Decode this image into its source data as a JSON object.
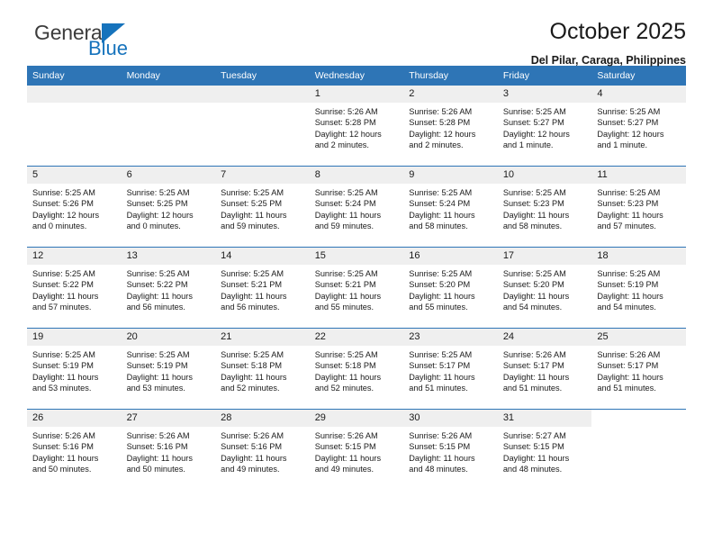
{
  "logo": {
    "word_top": "General",
    "word_bottom": "Blue",
    "triangle_color": "#1673bc"
  },
  "header": {
    "title": "October 2025",
    "location": "Del Pilar, Caraga, Philippines"
  },
  "calendar": {
    "accent_color": "#2e75b6",
    "daynum_band_color": "#efefef",
    "weekday_headers": [
      "Sunday",
      "Monday",
      "Tuesday",
      "Wednesday",
      "Thursday",
      "Friday",
      "Saturday"
    ],
    "labels": {
      "sunrise_prefix": "Sunrise:",
      "sunset_prefix": "Sunset:",
      "daylight_prefix": "Daylight:"
    },
    "weeks": [
      [
        {
          "day": "",
          "sunrise": "",
          "sunset": "",
          "daylight": "",
          "blank": true
        },
        {
          "day": "",
          "sunrise": "",
          "sunset": "",
          "daylight": "",
          "blank": true
        },
        {
          "day": "",
          "sunrise": "",
          "sunset": "",
          "daylight": "",
          "blank": true
        },
        {
          "day": "1",
          "sunrise": "Sunrise: 5:26 AM",
          "sunset": "Sunset: 5:28 PM",
          "daylight": "Daylight: 12 hours and 2 minutes."
        },
        {
          "day": "2",
          "sunrise": "Sunrise: 5:26 AM",
          "sunset": "Sunset: 5:28 PM",
          "daylight": "Daylight: 12 hours and 2 minutes."
        },
        {
          "day": "3",
          "sunrise": "Sunrise: 5:25 AM",
          "sunset": "Sunset: 5:27 PM",
          "daylight": "Daylight: 12 hours and 1 minute."
        },
        {
          "day": "4",
          "sunrise": "Sunrise: 5:25 AM",
          "sunset": "Sunset: 5:27 PM",
          "daylight": "Daylight: 12 hours and 1 minute."
        }
      ],
      [
        {
          "day": "5",
          "sunrise": "Sunrise: 5:25 AM",
          "sunset": "Sunset: 5:26 PM",
          "daylight": "Daylight: 12 hours and 0 minutes."
        },
        {
          "day": "6",
          "sunrise": "Sunrise: 5:25 AM",
          "sunset": "Sunset: 5:25 PM",
          "daylight": "Daylight: 12 hours and 0 minutes."
        },
        {
          "day": "7",
          "sunrise": "Sunrise: 5:25 AM",
          "sunset": "Sunset: 5:25 PM",
          "daylight": "Daylight: 11 hours and 59 minutes."
        },
        {
          "day": "8",
          "sunrise": "Sunrise: 5:25 AM",
          "sunset": "Sunset: 5:24 PM",
          "daylight": "Daylight: 11 hours and 59 minutes."
        },
        {
          "day": "9",
          "sunrise": "Sunrise: 5:25 AM",
          "sunset": "Sunset: 5:24 PM",
          "daylight": "Daylight: 11 hours and 58 minutes."
        },
        {
          "day": "10",
          "sunrise": "Sunrise: 5:25 AM",
          "sunset": "Sunset: 5:23 PM",
          "daylight": "Daylight: 11 hours and 58 minutes."
        },
        {
          "day": "11",
          "sunrise": "Sunrise: 5:25 AM",
          "sunset": "Sunset: 5:23 PM",
          "daylight": "Daylight: 11 hours and 57 minutes."
        }
      ],
      [
        {
          "day": "12",
          "sunrise": "Sunrise: 5:25 AM",
          "sunset": "Sunset: 5:22 PM",
          "daylight": "Daylight: 11 hours and 57 minutes."
        },
        {
          "day": "13",
          "sunrise": "Sunrise: 5:25 AM",
          "sunset": "Sunset: 5:22 PM",
          "daylight": "Daylight: 11 hours and 56 minutes."
        },
        {
          "day": "14",
          "sunrise": "Sunrise: 5:25 AM",
          "sunset": "Sunset: 5:21 PM",
          "daylight": "Daylight: 11 hours and 56 minutes."
        },
        {
          "day": "15",
          "sunrise": "Sunrise: 5:25 AM",
          "sunset": "Sunset: 5:21 PM",
          "daylight": "Daylight: 11 hours and 55 minutes."
        },
        {
          "day": "16",
          "sunrise": "Sunrise: 5:25 AM",
          "sunset": "Sunset: 5:20 PM",
          "daylight": "Daylight: 11 hours and 55 minutes."
        },
        {
          "day": "17",
          "sunrise": "Sunrise: 5:25 AM",
          "sunset": "Sunset: 5:20 PM",
          "daylight": "Daylight: 11 hours and 54 minutes."
        },
        {
          "day": "18",
          "sunrise": "Sunrise: 5:25 AM",
          "sunset": "Sunset: 5:19 PM",
          "daylight": "Daylight: 11 hours and 54 minutes."
        }
      ],
      [
        {
          "day": "19",
          "sunrise": "Sunrise: 5:25 AM",
          "sunset": "Sunset: 5:19 PM",
          "daylight": "Daylight: 11 hours and 53 minutes."
        },
        {
          "day": "20",
          "sunrise": "Sunrise: 5:25 AM",
          "sunset": "Sunset: 5:19 PM",
          "daylight": "Daylight: 11 hours and 53 minutes."
        },
        {
          "day": "21",
          "sunrise": "Sunrise: 5:25 AM",
          "sunset": "Sunset: 5:18 PM",
          "daylight": "Daylight: 11 hours and 52 minutes."
        },
        {
          "day": "22",
          "sunrise": "Sunrise: 5:25 AM",
          "sunset": "Sunset: 5:18 PM",
          "daylight": "Daylight: 11 hours and 52 minutes."
        },
        {
          "day": "23",
          "sunrise": "Sunrise: 5:25 AM",
          "sunset": "Sunset: 5:17 PM",
          "daylight": "Daylight: 11 hours and 51 minutes."
        },
        {
          "day": "24",
          "sunrise": "Sunrise: 5:26 AM",
          "sunset": "Sunset: 5:17 PM",
          "daylight": "Daylight: 11 hours and 51 minutes."
        },
        {
          "day": "25",
          "sunrise": "Sunrise: 5:26 AM",
          "sunset": "Sunset: 5:17 PM",
          "daylight": "Daylight: 11 hours and 51 minutes."
        }
      ],
      [
        {
          "day": "26",
          "sunrise": "Sunrise: 5:26 AM",
          "sunset": "Sunset: 5:16 PM",
          "daylight": "Daylight: 11 hours and 50 minutes."
        },
        {
          "day": "27",
          "sunrise": "Sunrise: 5:26 AM",
          "sunset": "Sunset: 5:16 PM",
          "daylight": "Daylight: 11 hours and 50 minutes."
        },
        {
          "day": "28",
          "sunrise": "Sunrise: 5:26 AM",
          "sunset": "Sunset: 5:16 PM",
          "daylight": "Daylight: 11 hours and 49 minutes."
        },
        {
          "day": "29",
          "sunrise": "Sunrise: 5:26 AM",
          "sunset": "Sunset: 5:15 PM",
          "daylight": "Daylight: 11 hours and 49 minutes."
        },
        {
          "day": "30",
          "sunrise": "Sunrise: 5:26 AM",
          "sunset": "Sunset: 5:15 PM",
          "daylight": "Daylight: 11 hours and 48 minutes."
        },
        {
          "day": "31",
          "sunrise": "Sunrise: 5:27 AM",
          "sunset": "Sunset: 5:15 PM",
          "daylight": "Daylight: 11 hours and 48 minutes."
        },
        {
          "day": "",
          "sunrise": "",
          "sunset": "",
          "daylight": "",
          "blank": true,
          "noband": true
        }
      ]
    ]
  }
}
